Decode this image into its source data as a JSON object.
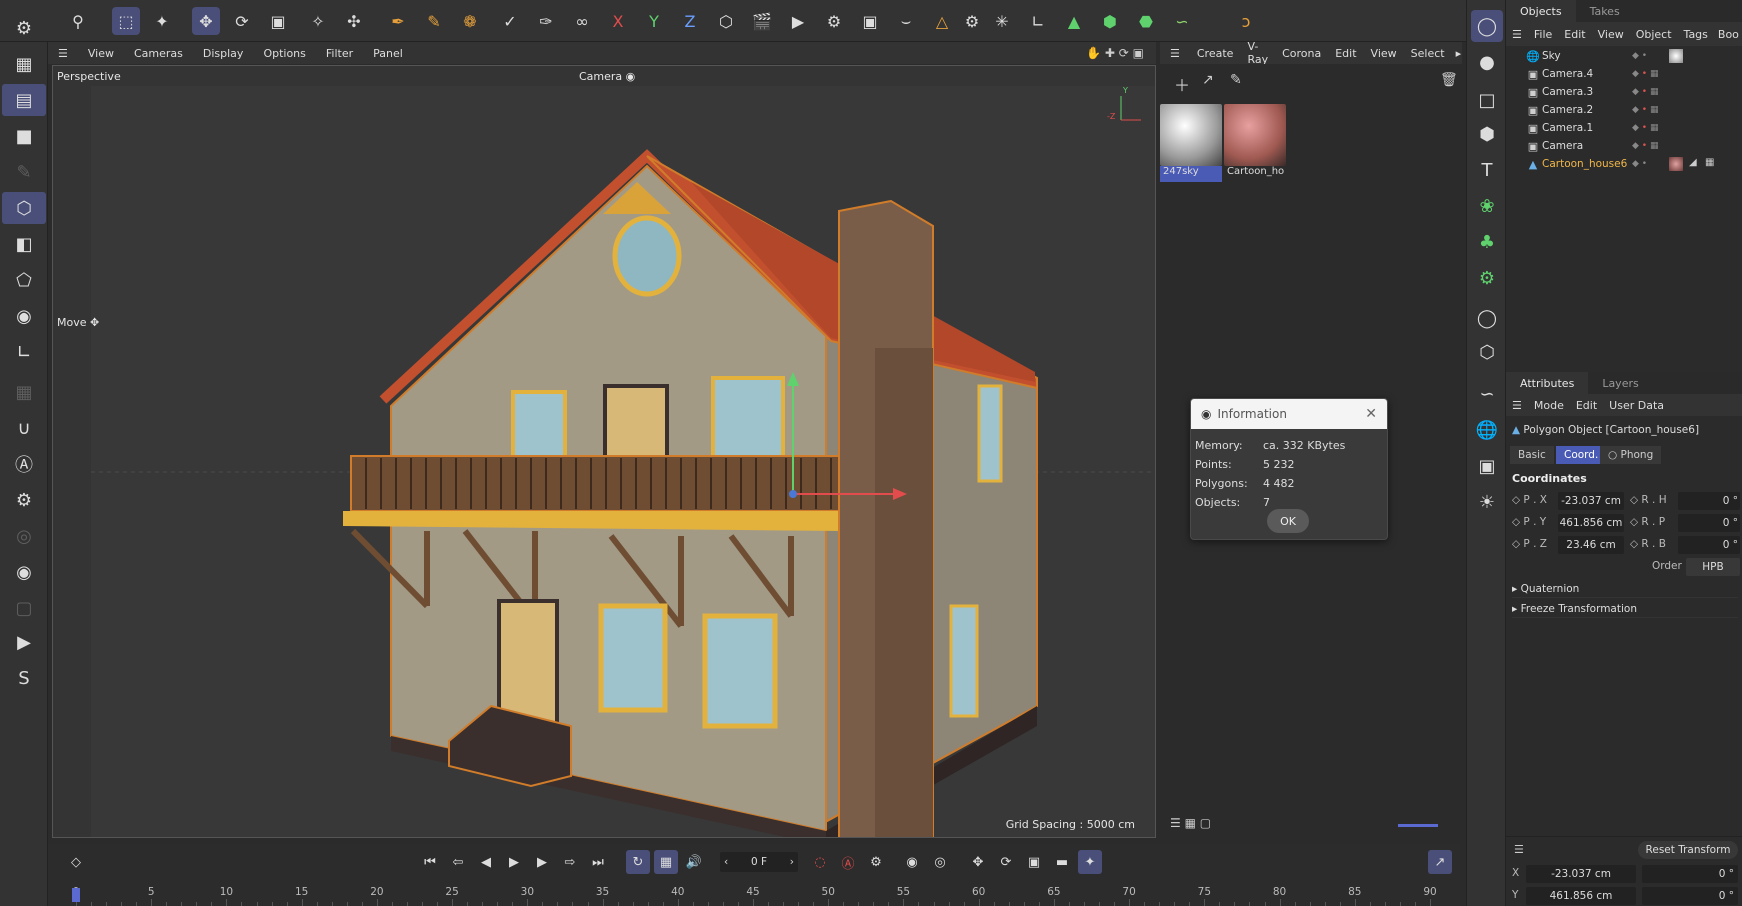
{
  "toolbar": {
    "icons": [
      "search-icon",
      "select-icon",
      "live-select-icon",
      "move-icon",
      "rotate-icon",
      "scale-icon",
      "transform-icon",
      "snap-icon",
      "spline-pen-icon",
      "spline-sketch-icon",
      "spline-draw-icon",
      "brush-icon",
      "knife-icon",
      "lasso-icon"
    ],
    "axis_x": "X",
    "axis_y": "Y",
    "axis_z": "Z"
  },
  "viewport": {
    "menu": [
      "View",
      "Cameras",
      "Display",
      "Options",
      "Filter",
      "Panel"
    ],
    "perspective_label": "Perspective",
    "camera_label": "Camera",
    "move_label": "Move",
    "grid_spacing": "Grid Spacing : 5000 cm"
  },
  "material_manager": {
    "menu": [
      "Create",
      "V-Ray",
      "Corona",
      "Edit",
      "View",
      "Select"
    ],
    "materials": [
      {
        "name": "247sky"
      },
      {
        "name": "Cartoon_ho"
      }
    ]
  },
  "info_dialog": {
    "title": "Information",
    "rows": [
      {
        "label": "Memory:",
        "value": "ca. 332 KBytes"
      },
      {
        "label": "Points:",
        "value": "5 232"
      },
      {
        "label": "Polygons:",
        "value": "4 482"
      },
      {
        "label": "Objects:",
        "value": "7"
      }
    ],
    "ok_label": "OK"
  },
  "object_manager": {
    "tabs": [
      "Objects",
      "Takes"
    ],
    "menu": [
      "File",
      "Edit",
      "View",
      "Object",
      "Tags",
      "Boo"
    ],
    "objects": [
      {
        "name": "Sky",
        "icon": "sky-icon"
      },
      {
        "name": "Camera.4",
        "icon": "camera-icon"
      },
      {
        "name": "Camera.3",
        "icon": "camera-icon"
      },
      {
        "name": "Camera.2",
        "icon": "camera-icon"
      },
      {
        "name": "Camera.1",
        "icon": "camera-icon"
      },
      {
        "name": "Camera",
        "icon": "camera-icon"
      },
      {
        "name": "Cartoon_house6",
        "icon": "polygon-icon",
        "selected": true
      }
    ]
  },
  "attribute_manager": {
    "tabs": [
      "Attributes",
      "Layers"
    ],
    "menu": [
      "Mode",
      "Edit",
      "User Data"
    ],
    "object_title": "Polygon Object [Cartoon_house6]",
    "subtabs": [
      "Basic",
      "Coord.",
      "Phong"
    ],
    "section": "Coordinates",
    "coords": [
      {
        "label": "P . X",
        "value": "-23.037 cm",
        "rlabel": "R . H",
        "rvalue": "0 °"
      },
      {
        "label": "P . Y",
        "value": "461.856 cm",
        "rlabel": "R . P",
        "rvalue": "0 °"
      },
      {
        "label": "P . Z",
        "value": "23.46 cm",
        "rlabel": "R . B",
        "rvalue": "0 °"
      }
    ],
    "order_label": "Order",
    "order_value": "HPB",
    "quaternion": "Quaternion",
    "freeze": "Freeze Transformation"
  },
  "timeline": {
    "current_frame": "0 F",
    "ruler": [
      "0",
      "5",
      "10",
      "15",
      "20",
      "25",
      "30",
      "35",
      "40",
      "45",
      "50",
      "55",
      "60",
      "65",
      "70",
      "75",
      "80",
      "85",
      "90"
    ]
  },
  "coord_manager": {
    "reset_label": "Reset Transform",
    "x_label": "X",
    "x_value": "-23.037 cm",
    "x_rot": "0 °",
    "y_label": "Y",
    "y_value": "461.856 cm",
    "y_rot": "0 °"
  },
  "colors": {
    "accent": "#4a4f7a",
    "selected_tab": "#4a5bb5",
    "roof": "#c2502e",
    "trim": "#e3b23c",
    "wall": "#a89e8a"
  }
}
